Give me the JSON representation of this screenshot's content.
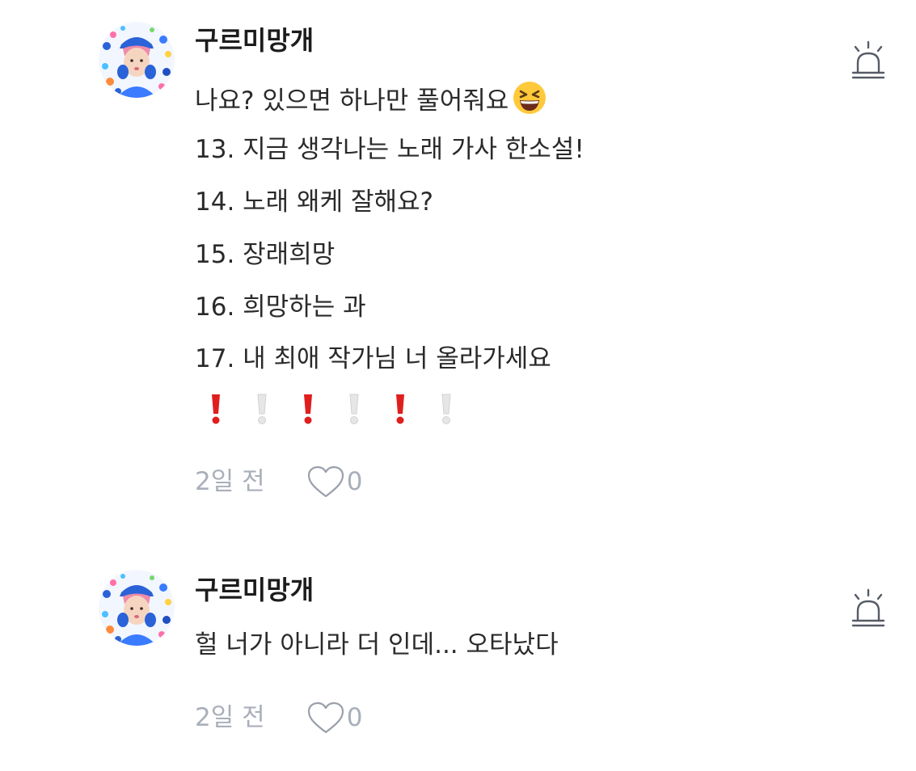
{
  "comments": [
    {
      "username": "구르미망개",
      "avatar_icon": "avatar-photo-icon",
      "lines": [
        "나요? 있으면 하나만 풀어줘요",
        "13. 지금 생각나는 노래 가사 한소설!",
        "14. 노래 왜케 잘해요?",
        "15. 장래희망",
        "16. 희망하는 과",
        "17. 내 최애 작가님 너 올라가세요"
      ],
      "emoji": "laughing-face-icon",
      "exclamation_marks": [
        "red",
        "white",
        "red",
        "white",
        "red",
        "white"
      ],
      "time": "2일 전",
      "likes": "0",
      "report_icon": "siren-report-icon"
    },
    {
      "username": "구르미망개",
      "avatar_icon": "avatar-photo-icon",
      "lines": [
        "헐 너가 아니라 더 인데... 오타났다"
      ],
      "time": "2일 전",
      "likes": "0",
      "report_icon": "siren-report-icon"
    }
  ],
  "colors": {
    "meta_text": "#a9afba",
    "body_text": "#2a2a2a",
    "username_text": "#1c1c1c",
    "exclamation_red": "#e01e1e",
    "exclamation_white": "#e6e6e6",
    "avatar_blue": "#2a62d8"
  }
}
